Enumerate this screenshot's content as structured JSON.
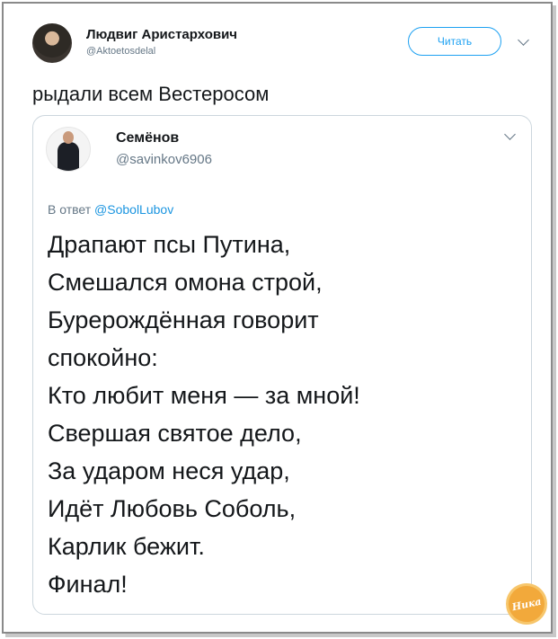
{
  "tweet": {
    "author_name": "Людвиг Аристархович",
    "author_handle": "@Aktoetosdelal",
    "follow_label": "Читать",
    "text": "рыдали всем Вестеросом"
  },
  "quoted": {
    "author_name": "Семёнов",
    "author_handle": "@savinkov6906",
    "reply_prefix": "В ответ",
    "reply_handle": "@SobolLubov",
    "lines": [
      "Драпают псы Путина,",
      "Смешался омона строй,",
      "Бурерождённая говорит",
      "спокойно:",
      "Кто любит меня — за мной!",
      "Свершая святое дело,",
      "За ударом неся удар,",
      "Идёт Любовь Соболь,",
      "Карлик бежит.",
      "Финал!"
    ]
  },
  "watermark": {
    "text": "Ника"
  },
  "colors": {
    "accent": "#1da1f2",
    "muted": "#657786",
    "text": "#14171a",
    "border": "#ccd6dd"
  }
}
